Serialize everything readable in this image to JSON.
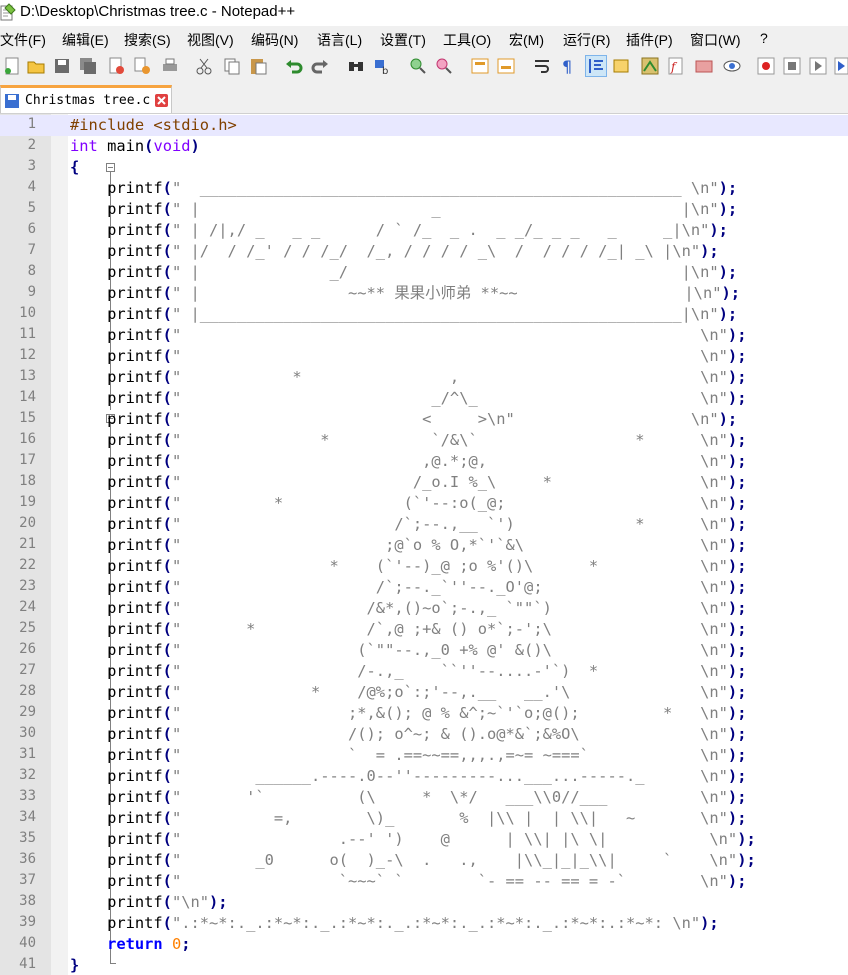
{
  "window": {
    "title": "D:\\Desktop\\Christmas tree.c - Notepad++"
  },
  "menu": [
    "文件(F)",
    "编辑(E)",
    "搜索(S)",
    "视图(V)",
    "编码(N)",
    "语言(L)",
    "设置(T)",
    "工具(O)",
    "宏(M)",
    "运行(R)",
    "插件(P)",
    "窗口(W)",
    "?"
  ],
  "toolbar": [
    "new-file-icon",
    "open-file-icon",
    "save-icon",
    "save-all-icon",
    "close-icon",
    "close-all-icon",
    "print-icon",
    "cut-icon",
    "copy-icon",
    "paste-icon",
    "undo-icon",
    "redo-icon",
    "find-icon",
    "replace-icon",
    "zoom-in-icon",
    "zoom-out-icon",
    "sync-vertical-icon",
    "sync-horizontal-icon",
    "word-wrap-icon",
    "show-all-chars-icon",
    "indent-guide-icon",
    "udl-icon",
    "doc-map-icon",
    "function-list-icon",
    "folder-workspace-icon",
    "monitoring-icon",
    "record-macro-icon",
    "stop-macro-icon",
    "play-macro-icon",
    "run-macro-icon"
  ],
  "tab": {
    "label": "Christmas tree.c"
  },
  "editor": {
    "current_line": 1,
    "tree_lines": [
      {
        "n": "1",
        "t": "#include <stdio.h>"
      },
      {
        "n": "2",
        "t": "int main(void)"
      },
      {
        "n": "3",
        "t": "{"
      },
      {
        "n": "4",
        "t": "    printf(\"  ____________________________________________________ \\n\");"
      },
      {
        "n": "5",
        "t": "    printf(\" |                         _                          |\\n\");"
      },
      {
        "n": "6",
        "t": "    printf(\" | /|,/ _   _ _      / ` /_  _ .  _ _/_ _ _   _     _|\\n\");"
      },
      {
        "n": "7",
        "t": "    printf(\" |/  / /_' / / /_/  /_, / / / / _\\  /  / / / /_| _\\ |\\n\");"
      },
      {
        "n": "8",
        "t": "    printf(\" |              _/                                    |\\n\");"
      },
      {
        "n": "9",
        "t": "    printf(\" |                ~~** 果果小师弟 **~~                  |\\n\");"
      },
      {
        "n": "10",
        "t": "    printf(\" |____________________________________________________|\\n\");"
      },
      {
        "n": "11",
        "t": "    printf(\"                                                        \\n\");"
      },
      {
        "n": "12",
        "t": "    printf(\"                                                        \\n\");"
      },
      {
        "n": "13",
        "t": "    printf(\"            *                ,                          \\n\");"
      },
      {
        "n": "14",
        "t": "    printf(\"                           _/^\\_                        \\n\");"
      },
      {
        "n": "15",
        "t": "    printf(\"                          <     >\\n\"                   \\n\");"
      },
      {
        "n": "16",
        "t": "    printf(\"               *           `/&\\`                 *      \\n\");"
      },
      {
        "n": "17",
        "t": "    printf(\"                          ,@.*;@,                       \\n\");"
      },
      {
        "n": "18",
        "t": "    printf(\"                         /_o.I %_\\     *                \\n\");"
      },
      {
        "n": "19",
        "t": "    printf(\"          *             (`'--:o(_@;                     \\n\");"
      },
      {
        "n": "20",
        "t": "    printf(\"                       /`;--.,__ `')             *      \\n\");"
      },
      {
        "n": "21",
        "t": "    printf(\"                      ;@`o % O,*`'`&\\                   \\n\");"
      },
      {
        "n": "22",
        "t": "    printf(\"                *    (`'--)_@ ;o %'()\\      *           \\n\");"
      },
      {
        "n": "23",
        "t": "    printf(\"                     /`;--._`''--._O'@;                 \\n\");"
      },
      {
        "n": "24",
        "t": "    printf(\"                    /&*,()~o`;-.,_ `\"\"`)                \\n\");"
      },
      {
        "n": "25",
        "t": "    printf(\"       *            /`,@ ;+& () o*`;-';\\                \\n\");"
      },
      {
        "n": "26",
        "t": "    printf(\"                   (`\"\"--.,_0 +% @' &()\\                \\n\");"
      },
      {
        "n": "27",
        "t": "    printf(\"                   /-.,_    ``''--....-'`)  *           \\n\");"
      },
      {
        "n": "28",
        "t": "    printf(\"              *    /@%;o`:;'--,.__   __.'\\              \\n\");"
      },
      {
        "n": "29",
        "t": "    printf(\"                  ;*,&(); @ % &^;~`'`o;@();         *   \\n\");"
      },
      {
        "n": "30",
        "t": "    printf(\"                  /(); o^~; & ().o@*&`;&%O\\             \\n\");"
      },
      {
        "n": "31",
        "t": "    printf(\"                  `  = .==~~==,,,.,=~= ~===`            \\n\");"
      },
      {
        "n": "32",
        "t": "    printf(\"        ______.----.0--''---------...___...-----._      \\n\");"
      },
      {
        "n": "33",
        "t": "    printf(\"       '`          (\\     *  \\*/   ___\\\\0//___          \\n\");"
      },
      {
        "n": "34",
        "t": "    printf(\"          =,        \\)_       %  |\\\\ |  | \\\\|   ~       \\n\");"
      },
      {
        "n": "35",
        "t": "    printf(\"                 .--' ')    @      | \\\\| |\\ \\|           \\n\");"
      },
      {
        "n": "36",
        "t": "    printf(\"        _0      o(  )_-\\  .   .,    |\\\\_|_|_\\\\|     `    \\n\");"
      },
      {
        "n": "37",
        "t": "    printf(\"                 `~~~` `        `- == -- == = -`        \\n\");"
      },
      {
        "n": "38",
        "t": "    printf(\"\\n\");"
      },
      {
        "n": "39",
        "t": "    printf(\".:*~*:._.:*~*:._.:*~*:._.:*~*:._.:*~*:._.:*~*:.:*~*: \\n\");"
      },
      {
        "n": "40",
        "t": "    return 0;"
      },
      {
        "n": "41",
        "t": "}"
      }
    ]
  }
}
